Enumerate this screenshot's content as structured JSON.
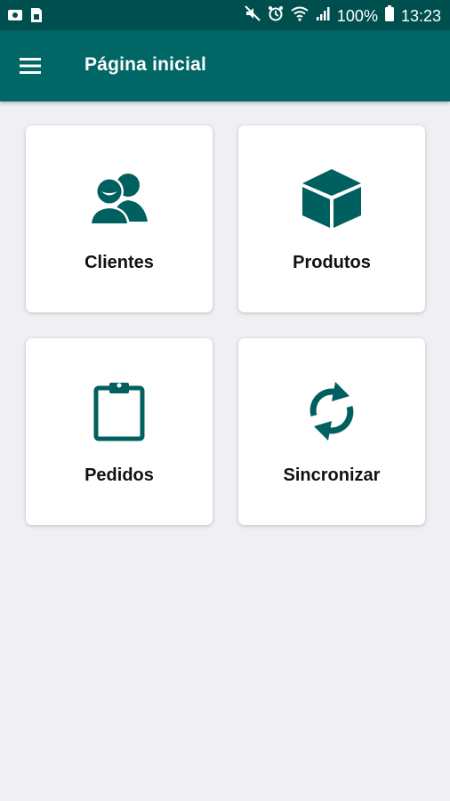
{
  "status_bar": {
    "battery": "100%",
    "time": "13:23"
  },
  "app_bar": {
    "title": "Página inicial",
    "menu_icon": "menu-icon"
  },
  "colors": {
    "status_bar_bg": "#004f4f",
    "app_bar_bg": "#006666",
    "icon_teal": "#005f5f",
    "page_bg": "#f0f0f4"
  },
  "menu": {
    "cards": [
      {
        "label": "Clientes",
        "icon": "clients-icon"
      },
      {
        "label": "Produtos",
        "icon": "box-icon"
      },
      {
        "label": "Pedidos",
        "icon": "clipboard-icon"
      },
      {
        "label": "Sincronizar",
        "icon": "sync-icon"
      }
    ]
  }
}
